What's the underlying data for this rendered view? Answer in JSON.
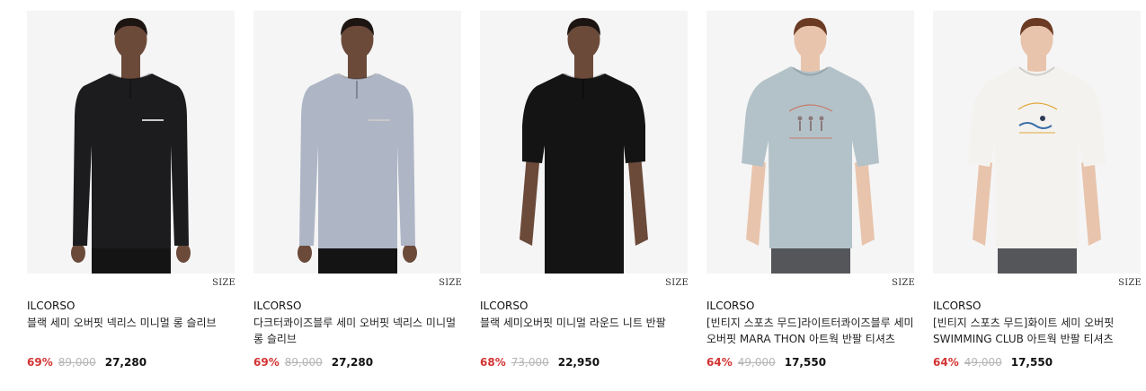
{
  "products": [
    {
      "brand": "ILCORSO",
      "name": "블랙 세미 오버핏 넥리스 미니멀 롱 슬리브",
      "discount": "69%",
      "original_price": "89,000",
      "sale_price": "27,280",
      "size_label": "SIZE",
      "shirt_color": "#1c1c1e",
      "shirt_type": "longsleeve-zip",
      "skin": "#6b4a3a",
      "hair": "#1d1512",
      "pants": "#141414"
    },
    {
      "brand": "ILCORSO",
      "name": "다크터콰이즈블루 세미 오버핏 넥리스 미니멀 롱 슬리브",
      "discount": "69%",
      "original_price": "89,000",
      "sale_price": "27,280",
      "size_label": "SIZE",
      "shirt_color": "#aeb6c6",
      "shirt_type": "longsleeve-zip",
      "skin": "#6b4a3a",
      "hair": "#1d1512",
      "pants": "#141414"
    },
    {
      "brand": "ILCORSO",
      "name": "블랙 세미오버핏 미니멀 라운드 니트 반팔",
      "discount": "68%",
      "original_price": "73,000",
      "sale_price": "22,950",
      "size_label": "SIZE",
      "shirt_color": "#141414",
      "shirt_type": "shortsleeve-slit",
      "skin": "#6b4a3a",
      "hair": "#1d1512",
      "pants": "#141414"
    },
    {
      "brand": "ILCORSO",
      "name": "[빈티지 스포츠 무드]라이트터콰이즈블루 세미 오버핏 MARA THON 아트웍 반팔 티셔츠",
      "discount": "64%",
      "original_price": "49,000",
      "sale_price": "17,550",
      "size_label": "SIZE",
      "shirt_color": "#b3c2c9",
      "shirt_type": "tee-print-marathon",
      "skin": "#e8c4ad",
      "hair": "#6b3a22",
      "pants": "#55565a"
    },
    {
      "brand": "ILCORSO",
      "name": "[빈티지 스포츠 무드]화이트 세미 오버핏 SWIMMING CLUB 아트웍 반팔 티셔츠",
      "discount": "64%",
      "original_price": "49,000",
      "sale_price": "17,550",
      "size_label": "SIZE",
      "shirt_color": "#f4f2ee",
      "shirt_type": "tee-print-swim",
      "skin": "#e8c4ad",
      "hair": "#6b3a22",
      "pants": "#55565a"
    }
  ],
  "colors": {
    "discount": "#d33333",
    "original_price": "#b5b5b5",
    "image_bg": "#f5f5f5"
  }
}
